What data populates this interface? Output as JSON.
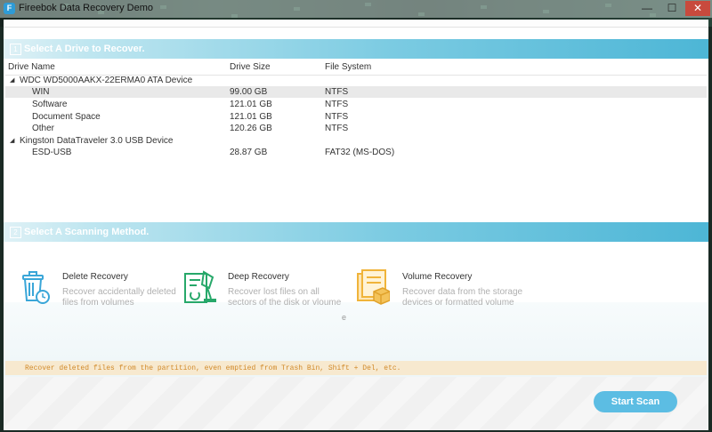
{
  "window": {
    "title": "Fireebok Data Recovery Demo",
    "minimize_glyph": "—",
    "maximize_glyph": "☐",
    "close_glyph": "✕"
  },
  "drive_section": {
    "number": "1",
    "title": "Select A Drive to Recover.",
    "columns": [
      "Drive Name",
      "Drive Size",
      "File System"
    ],
    "devices": [
      {
        "name": "WDC WD5000AAKX-22ERMA0 ATA Device",
        "partitions": [
          {
            "name": "WIN",
            "size": "99.00 GB",
            "fs": "NTFS",
            "selected": true
          },
          {
            "name": "Software",
            "size": "121.01 GB",
            "fs": "NTFS"
          },
          {
            "name": "Document Space",
            "size": "121.01 GB",
            "fs": "NTFS"
          },
          {
            "name": "Other",
            "size": "120.26 GB",
            "fs": "NTFS"
          }
        ]
      },
      {
        "name": "Kingston DataTraveler 3.0 USB Device",
        "partitions": [
          {
            "name": "ESD-USB",
            "size": "28.87 GB",
            "fs": "FAT32 (MS-DOS)"
          }
        ]
      }
    ]
  },
  "scan_section": {
    "number": "2",
    "title": "Select A Scanning Method.",
    "methods": [
      {
        "name": "Delete Recovery",
        "desc": "Recover accidentally deleted files from volumes",
        "icon": "trash-clock-icon",
        "color": "#3aa6d8"
      },
      {
        "name": "Deep Recovery",
        "desc": "Recover lost files on all sectors of the disk or vloume",
        "icon": "document-scan-icon",
        "color": "#27a86a"
      },
      {
        "name": "Volume Recovery",
        "desc": "Recover data from the storage devices or formatted volume",
        "icon": "volume-files-icon",
        "color": "#f0b43a"
      }
    ],
    "stray_char": "e",
    "hint": "Recover deleted files from the partition, even emptied from Trash Bin, Shift + Del, etc."
  },
  "actions": {
    "start_scan": "Start Scan"
  },
  "colors": {
    "accent": "#4db6d6",
    "hint_text": "#d18a2a",
    "button": "#5cbde3"
  }
}
